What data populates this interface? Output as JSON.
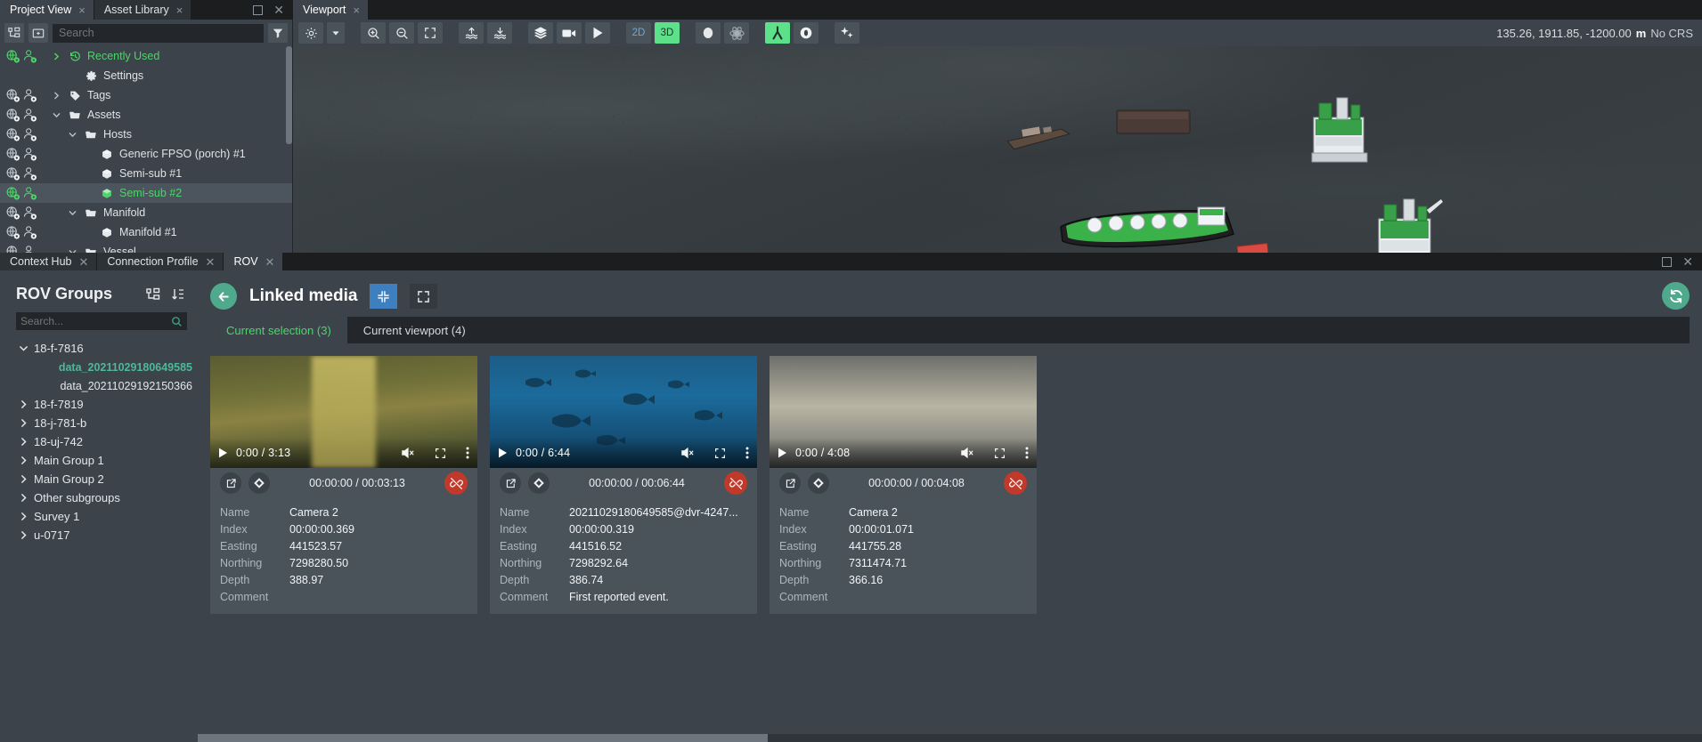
{
  "top_tabs": {
    "left": [
      {
        "label": "Project View",
        "active": true,
        "close": "×"
      },
      {
        "label": "Asset Library",
        "active": false,
        "close": "×"
      }
    ],
    "right": [
      {
        "label": "Viewport",
        "active": true,
        "close": "×"
      }
    ]
  },
  "asset_panel": {
    "toolbar": {
      "tree_view_icon": "tree-view-icon",
      "new_folder_icon": "new-folder-icon",
      "filter_icon": "filter-icon",
      "search_value": "",
      "search_placeholder": "Search"
    },
    "tree": [
      {
        "label": "Recently Used",
        "indent": 0,
        "chevron": "›",
        "icon": "history-icon",
        "green": true,
        "selected": false,
        "gutter": true
      },
      {
        "label": "Settings",
        "indent": 1,
        "chevron": "",
        "icon": "gear-icon",
        "green": false,
        "selected": false,
        "gutter": false
      },
      {
        "label": "Tags",
        "indent": 0,
        "chevron": "›",
        "icon": "tag-icon",
        "green": false,
        "selected": false,
        "gutter": false
      },
      {
        "label": "Assets",
        "indent": 0,
        "chevron": "⌄",
        "icon": "folder-icon",
        "green": false,
        "selected": false,
        "gutter": false
      },
      {
        "label": "Hosts",
        "indent": 1,
        "chevron": "⌄",
        "icon": "folder-icon",
        "green": false,
        "selected": false,
        "gutter": false
      },
      {
        "label": "Generic FPSO (porch) #1",
        "indent": 2,
        "chevron": "",
        "icon": "cube-icon",
        "green": false,
        "selected": false,
        "gutter": false
      },
      {
        "label": "Semi-sub #1",
        "indent": 2,
        "chevron": "",
        "icon": "cube-icon",
        "green": false,
        "selected": false,
        "gutter": false
      },
      {
        "label": "Semi-sub #2",
        "indent": 2,
        "chevron": "",
        "icon": "cube-icon",
        "green": true,
        "selected": true,
        "gutter": true
      },
      {
        "label": "Manifold",
        "indent": 1,
        "chevron": "⌄",
        "icon": "folder-icon",
        "green": false,
        "selected": false,
        "gutter": false
      },
      {
        "label": "Manifold #1",
        "indent": 2,
        "chevron": "",
        "icon": "cube-icon",
        "green": false,
        "selected": false,
        "gutter": false
      },
      {
        "label": "Vessel",
        "indent": 1,
        "chevron": "⌄",
        "icon": "folder-icon",
        "green": false,
        "selected": false,
        "gutter": false
      }
    ]
  },
  "viewport": {
    "toolbar": [
      {
        "name": "settings-gear-button",
        "glyph": "gear",
        "state": "normal",
        "label": ""
      },
      {
        "name": "settings-dropdown-button",
        "glyph": "caret",
        "state": "normal",
        "label": ""
      },
      {
        "name": "zoom-in-button",
        "glyph": "zoom-in",
        "state": "normal",
        "label": ""
      },
      {
        "name": "zoom-out-button",
        "glyph": "zoom-out",
        "state": "normal",
        "label": ""
      },
      {
        "name": "fit-to-screen-button",
        "glyph": "fit",
        "state": "normal",
        "label": ""
      },
      {
        "name": "raise-water-level-button",
        "glyph": "water-up",
        "state": "normal",
        "label": ""
      },
      {
        "name": "lower-water-level-button",
        "glyph": "water-down",
        "state": "normal",
        "label": ""
      },
      {
        "name": "layers-button",
        "glyph": "layers",
        "state": "normal",
        "label": ""
      },
      {
        "name": "record-button",
        "glyph": "camera",
        "state": "normal",
        "label": ""
      },
      {
        "name": "play-button",
        "glyph": "play",
        "state": "normal",
        "label": ""
      },
      {
        "name": "view-2d-button",
        "glyph": "text",
        "state": "dim",
        "label": "2D"
      },
      {
        "name": "view-3d-button",
        "glyph": "text",
        "state": "on",
        "label": "3D"
      },
      {
        "name": "sphere-button",
        "glyph": "sphere",
        "state": "normal",
        "label": ""
      },
      {
        "name": "orbit-button",
        "glyph": "orbit",
        "state": "dim",
        "label": ""
      },
      {
        "name": "walk-mode-button",
        "glyph": "walk",
        "state": "on",
        "label": ""
      },
      {
        "name": "target-button",
        "glyph": "target",
        "state": "normal",
        "label": ""
      },
      {
        "name": "effects-button",
        "glyph": "sparkle",
        "state": "normal",
        "label": ""
      }
    ],
    "coordinates": "135.26, 1911.85, -1200.00",
    "unit": "m",
    "crs": "No CRS",
    "compass": "compass-rose"
  },
  "dock_tabs": [
    {
      "label": "Context Hub",
      "active": false
    },
    {
      "label": "Connection Profile",
      "active": false
    },
    {
      "label": "ROV",
      "active": true
    }
  ],
  "rov_groups": {
    "title": "ROV Groups",
    "header_icons": [
      "group-tree-icon",
      "sort-az-icon"
    ],
    "search_value": "",
    "search_placeholder": "Search...",
    "search_icon": "search-icon",
    "items": [
      {
        "label": "18-f-7816",
        "chevron": "⌄",
        "child": false,
        "selected": false
      },
      {
        "label": "data_20211029180649585",
        "chevron": "",
        "child": true,
        "selected": true
      },
      {
        "label": "data_20211029192150366",
        "chevron": "",
        "child": true,
        "selected": false
      },
      {
        "label": "18-f-7819",
        "chevron": "›",
        "child": false,
        "selected": false
      },
      {
        "label": "18-j-781-b",
        "chevron": "›",
        "child": false,
        "selected": false
      },
      {
        "label": "18-uj-742",
        "chevron": "›",
        "child": false,
        "selected": false
      },
      {
        "label": "Main Group 1",
        "chevron": "›",
        "child": false,
        "selected": false
      },
      {
        "label": "Main Group 2",
        "chevron": "›",
        "child": false,
        "selected": false
      },
      {
        "label": "Other subgroups",
        "chevron": "›",
        "child": false,
        "selected": false
      },
      {
        "label": "Survey 1",
        "chevron": "›",
        "child": false,
        "selected": false
      },
      {
        "label": "u-0717",
        "chevron": "›",
        "child": false,
        "selected": false
      }
    ]
  },
  "linked_media": {
    "title": "Linked media",
    "back_icon": "arrow-left-icon",
    "refresh_icon": "refresh-icon",
    "view_buttons": [
      {
        "name": "compact-view-button",
        "icon": "collapse-arrows-icon",
        "active": true
      },
      {
        "name": "expand-view-button",
        "icon": "expand-arrows-icon",
        "active": false
      }
    ],
    "tabs": [
      {
        "label": "Current selection (3)",
        "active": true
      },
      {
        "label": "Current viewport (4)",
        "active": false
      }
    ],
    "field_labels": [
      "Name",
      "Index",
      "Easting",
      "Northing",
      "Depth",
      "Comment"
    ],
    "cards": [
      {
        "thumb": "murky-green-underwater",
        "player": {
          "play_icon": "play-icon",
          "time": "0:00 / 3:13",
          "mute_icon": "muted-icon",
          "fullscreen_icon": "fullscreen-icon",
          "more_icon": "more-vertical-icon"
        },
        "open_icon": "open-external-icon",
        "marker_icon": "diamond-marker-icon",
        "unlink_icon": "unlink-icon",
        "timecode": "00:00:00 / 00:03:13",
        "name": "Camera 2",
        "index": "00:00:00.369",
        "easting": "441523.57",
        "northing": "7298280.50",
        "depth": "388.97",
        "comment": ""
      },
      {
        "thumb": "blue-water-with-fish",
        "player": {
          "play_icon": "play-icon",
          "time": "0:00 / 6:44",
          "mute_icon": "muted-icon",
          "fullscreen_icon": "fullscreen-icon",
          "more_icon": "more-vertical-icon"
        },
        "open_icon": "open-external-icon",
        "marker_icon": "diamond-marker-icon",
        "unlink_icon": "unlink-icon",
        "timecode": "00:00:00 / 00:06:44",
        "name": "20211029180649585@dvr-4247...",
        "index": "00:00:00.319",
        "easting": "441516.52",
        "northing": "7298292.64",
        "depth": "386.74",
        "comment": "First reported event."
      },
      {
        "thumb": "hazy-seabed",
        "player": {
          "play_icon": "play-icon",
          "time": "0:00 / 4:08",
          "mute_icon": "muted-icon",
          "fullscreen_icon": "fullscreen-icon",
          "more_icon": "more-vertical-icon"
        },
        "open_icon": "open-external-icon",
        "marker_icon": "diamond-marker-icon",
        "unlink_icon": "unlink-icon",
        "timecode": "00:00:00 / 00:04:08",
        "name": "Camera 2",
        "index": "00:00:01.071",
        "easting": "441755.28",
        "northing": "7311474.71",
        "depth": "366.16",
        "comment": ""
      }
    ]
  },
  "window_controls": {
    "restore": "restore-icon",
    "close": "close-icon"
  },
  "colors": {
    "accent_green": "#4ed46b",
    "teal": "#4fa98d",
    "panel": "#3c434a",
    "panel_dark": "#23272b",
    "blue": "#3d7fbf",
    "red": "#c0392b"
  }
}
